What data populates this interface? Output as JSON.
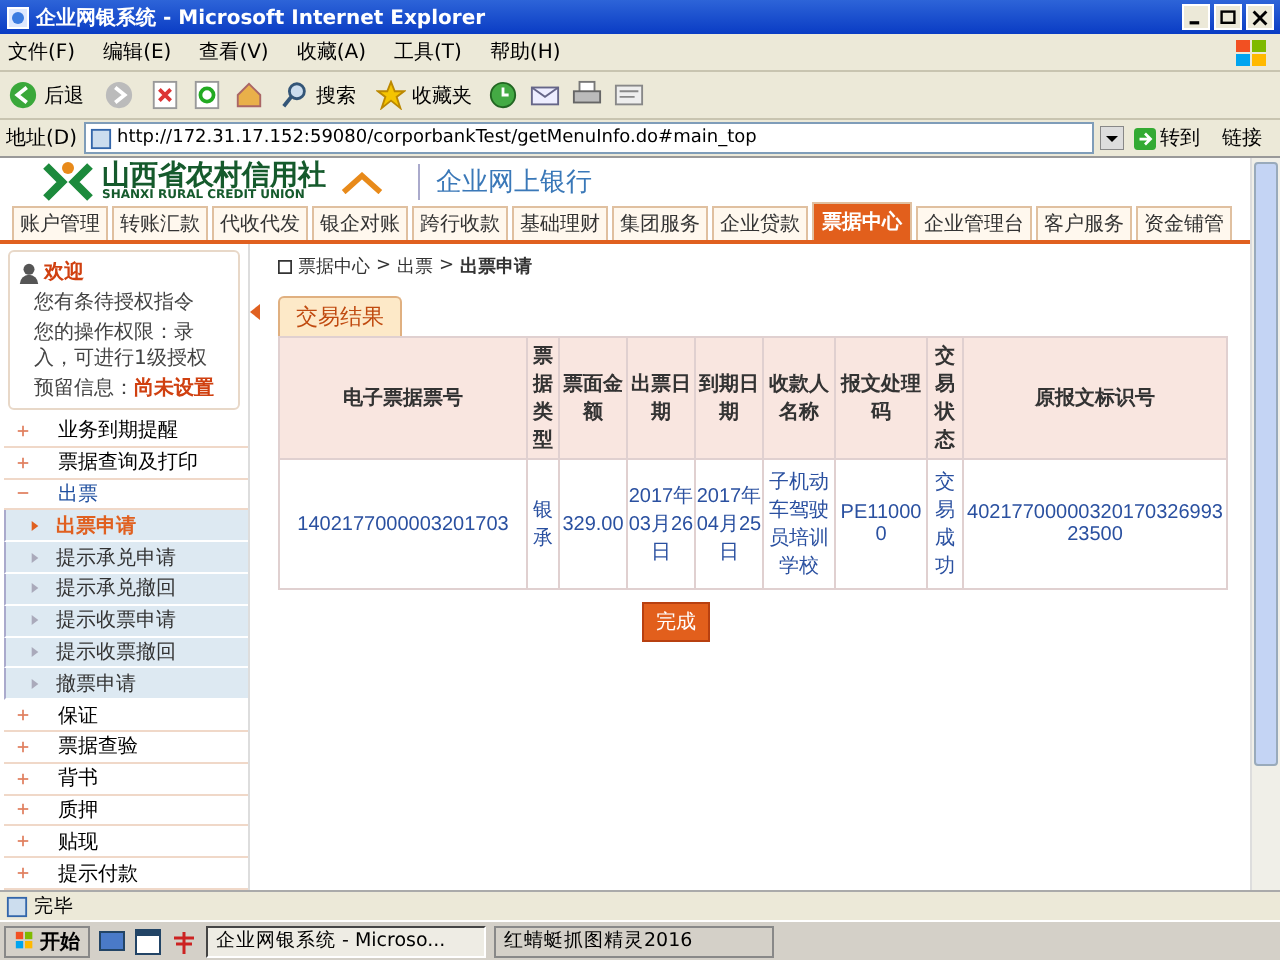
{
  "window": {
    "title": "企业网银系统 - Microsoft Internet Explorer"
  },
  "menu_bar": [
    "文件(F)",
    "编辑(E)",
    "查看(V)",
    "收藏(A)",
    "工具(T)",
    "帮助(H)"
  ],
  "toolbar": {
    "back": "后退",
    "search": "搜索",
    "favorites": "收藏夹"
  },
  "address_bar": {
    "label": "地址(D)",
    "url": "http://172.31.17.152:59080/corporbankTest/getMenuInfo.do#main_top",
    "go": "转到",
    "links": "链接"
  },
  "header": {
    "name": "山西省农村信用社",
    "name_en": "SHANXI RURAL CREDIT UNION",
    "subtitle": "企业网上银行"
  },
  "nav_tabs": [
    {
      "label": "账户管理",
      "selected": false
    },
    {
      "label": "转账汇款",
      "selected": false
    },
    {
      "label": "代收代发",
      "selected": false
    },
    {
      "label": "银企对账",
      "selected": false
    },
    {
      "label": "跨行收款",
      "selected": false
    },
    {
      "label": "基础理财",
      "selected": false
    },
    {
      "label": "集团服务",
      "selected": false
    },
    {
      "label": "企业贷款",
      "selected": false
    },
    {
      "label": "票据中心",
      "selected": true
    },
    {
      "label": "企业管理台",
      "selected": false
    },
    {
      "label": "客户服务",
      "selected": false
    },
    {
      "label": "资金铺管",
      "selected": false
    }
  ],
  "user_panel": {
    "welcome": "欢迎",
    "pending": "您有条待授权指令",
    "permission": "您的操作权限：录入，可进行1级授权",
    "reserved_label": "预留信息：",
    "reserved_value": "尚未设置"
  },
  "sidebar": [
    {
      "label": "业务到期提醒",
      "expanded": false
    },
    {
      "label": "票据查询及打印",
      "expanded": false
    },
    {
      "label": "出票",
      "expanded": true,
      "children": [
        {
          "label": "出票申请",
          "selected": true
        },
        {
          "label": "提示承兑申请",
          "selected": false
        },
        {
          "label": "提示承兑撤回",
          "selected": false
        },
        {
          "label": "提示收票申请",
          "selected": false
        },
        {
          "label": "提示收票撤回",
          "selected": false
        },
        {
          "label": "撤票申请",
          "selected": false
        }
      ]
    },
    {
      "label": "保证",
      "expanded": false
    },
    {
      "label": "票据查验",
      "expanded": false
    },
    {
      "label": "背书",
      "expanded": false
    },
    {
      "label": "质押",
      "expanded": false
    },
    {
      "label": "贴现",
      "expanded": false
    },
    {
      "label": "提示付款",
      "expanded": false
    }
  ],
  "breadcrumb": [
    "票据中心",
    "出票",
    "出票申请"
  ],
  "breadcrumb_separators": [
    ">",
    ">"
  ],
  "result_tab": "交易结果",
  "table": {
    "columns": [
      "电子票据票号",
      "票据类型",
      "票面金额",
      "出票日期",
      "到期日期",
      "收款人名称",
      "报文处理码",
      "交易状态",
      "原报文标识号"
    ],
    "rows": [
      [
        "1402177000003201703",
        "银承",
        "329.00",
        "2017年03月26日",
        "2017年04月25日",
        "子机动车驾驶员培训学校",
        "PE110000",
        "交易成功",
        "4021770000032017032699323500"
      ]
    ]
  },
  "done_button": "完成",
  "status_bar": {
    "text": "完毕"
  },
  "taskbar": {
    "start": "开始",
    "tasks": [
      {
        "label": "企业网银系统 - Microso...",
        "selected": true
      },
      {
        "label": "红蜻蜓抓图精灵2016",
        "selected": false
      }
    ]
  }
}
